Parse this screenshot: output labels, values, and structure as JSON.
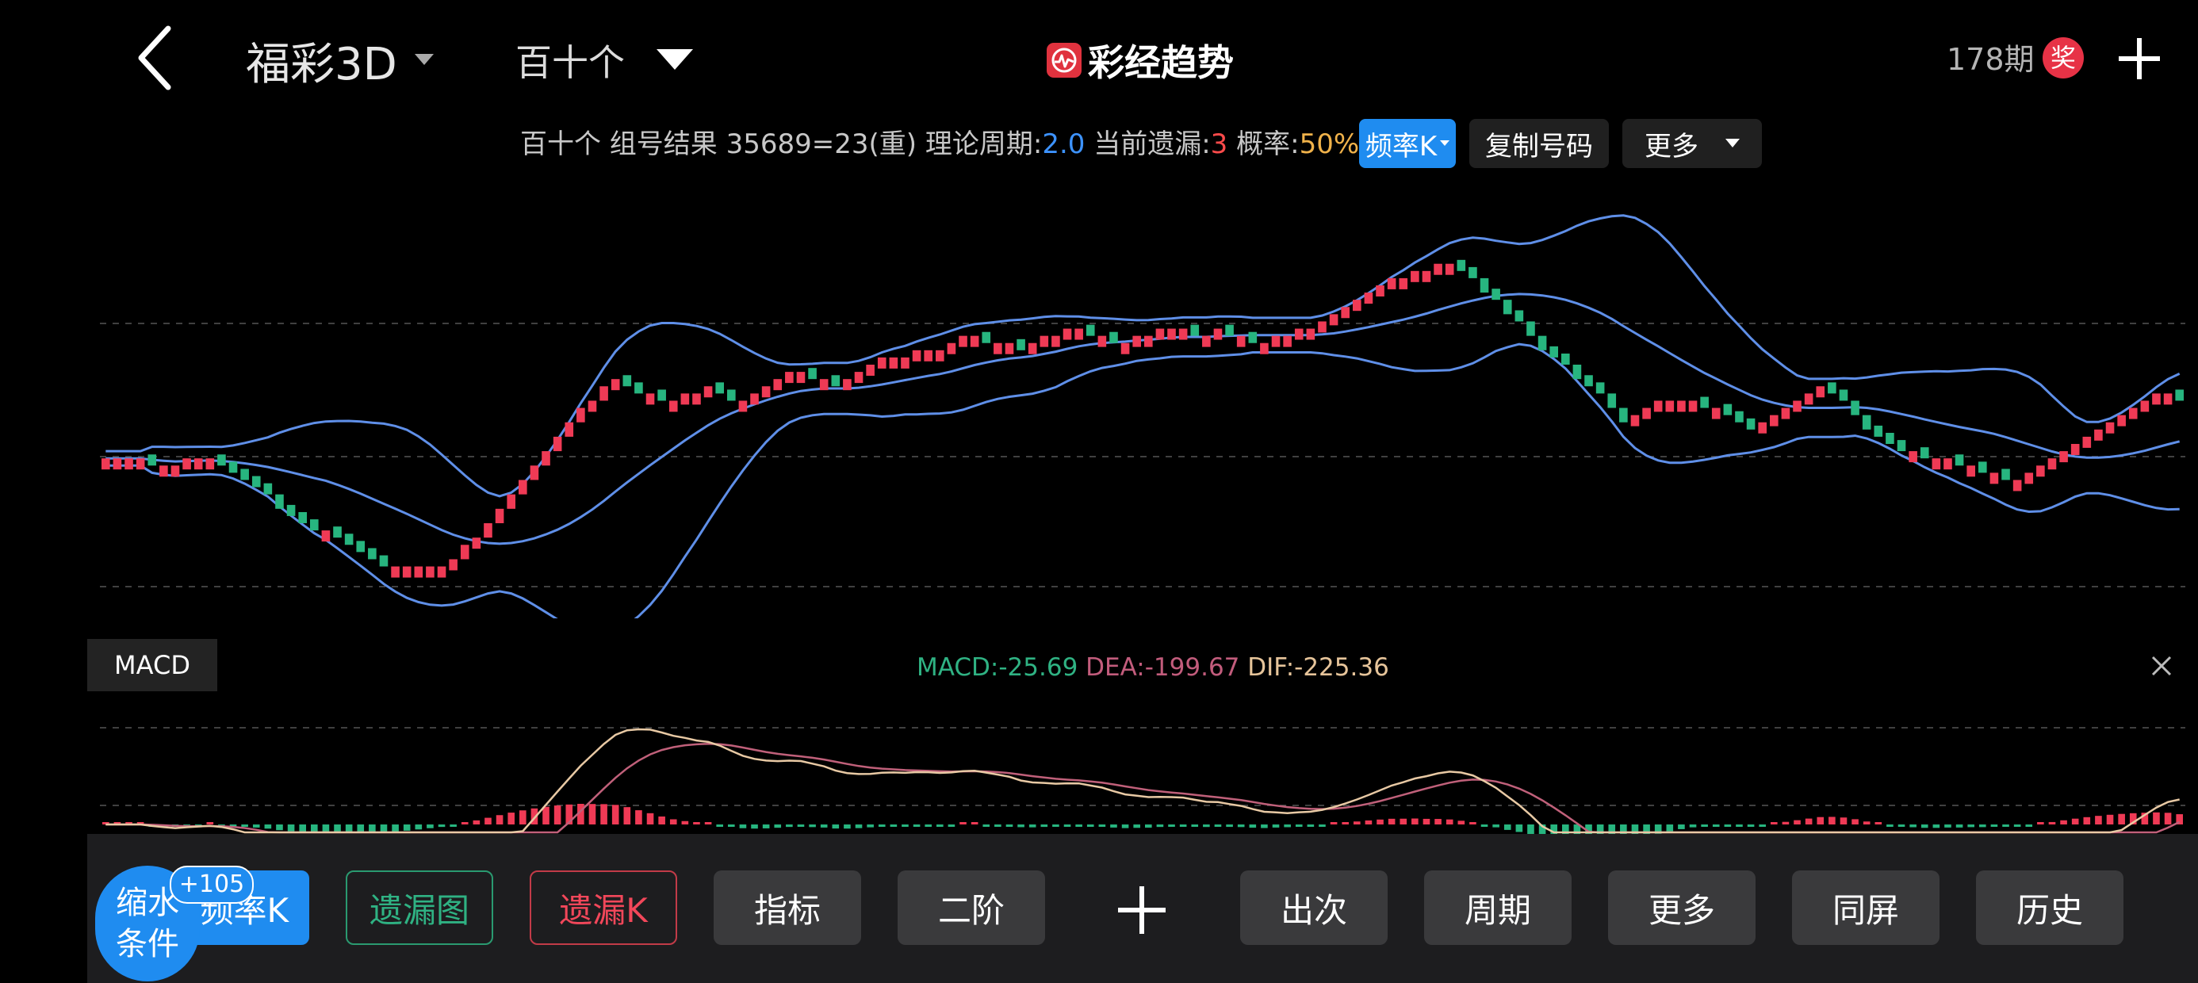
{
  "header": {
    "lottery_name": "福彩3D",
    "position_selector": "百十个",
    "app_title": "彩经趋势",
    "period_count": "178期",
    "prize_badge": "奖"
  },
  "info_bar": {
    "prefix": "百十个 组号结果 35689=23(重) 理论周期:",
    "theoretical_cycle": "2.0",
    "current_missing_label": " 当前遗漏:",
    "current_missing": "3",
    "probability_label": " 概率:",
    "probability": "50%",
    "freq_k_button": "频率K",
    "copy_button": "复制号码",
    "more_button": "更多"
  },
  "macd": {
    "label": "MACD",
    "macd_text": "MACD:-25.69",
    "dea_text": "DEA:-199.67",
    "dif_text": "DIF:-225.36"
  },
  "toolbar": {
    "shrink_line1": "缩水",
    "shrink_line2": "条件",
    "count_badge": "+105",
    "freq_k": "频率K",
    "missing_chart": "遗漏图",
    "missing_k": "遗漏K",
    "indicator": "指标",
    "second_order": "二阶",
    "occurrences": "出次",
    "period": "周期",
    "more": "更多",
    "split_screen": "同屏",
    "history": "历史"
  },
  "colors": {
    "background": "#000000",
    "up": "#ef3a55",
    "down": "#27b57f",
    "band": "#5f8fe8",
    "accent_blue": "#1f8cf0",
    "dif_line": "#e8c9a4",
    "dea_line": "#c0607a"
  },
  "chart_data": [
    {
      "type": "candlestick",
      "title": "",
      "candle_count": 180,
      "series": [
        {
          "values": [
            50,
            50,
            50,
            50,
            49,
            49,
            49,
            50,
            50,
            50,
            49,
            48,
            47,
            46,
            45,
            43,
            42,
            41,
            40,
            40,
            39,
            38,
            37,
            36,
            35,
            35,
            35,
            35,
            35,
            35,
            36,
            38,
            39,
            41,
            43,
            45,
            47,
            49,
            51,
            53,
            55,
            57,
            58,
            60,
            61,
            60,
            59,
            59,
            58,
            58,
            59,
            59,
            60,
            59,
            58,
            58,
            59,
            60,
            61,
            62,
            62,
            61,
            61,
            60,
            61,
            62,
            63,
            64,
            64,
            64,
            65,
            65,
            65,
            66,
            67,
            67,
            66,
            66,
            66,
            65,
            66,
            67,
            67,
            68,
            68,
            67,
            67,
            66,
            66,
            67,
            67,
            68,
            68,
            68,
            67,
            67,
            68,
            67,
            67,
            66,
            66,
            67,
            67,
            68,
            68,
            69,
            70,
            71,
            72,
            73,
            74,
            75,
            75,
            76,
            76,
            77,
            77,
            76,
            75,
            73,
            72,
            70,
            69,
            67,
            65,
            64,
            63,
            61,
            60,
            59,
            57,
            55,
            56,
            57,
            58,
            58,
            58,
            58,
            57,
            57,
            56,
            55,
            54,
            55,
            56,
            57,
            58,
            59,
            60,
            59,
            58,
            56,
            54,
            53,
            52,
            51,
            51,
            50,
            50,
            50,
            49,
            49,
            48,
            48,
            47,
            47,
            48,
            49,
            50,
            51,
            52,
            53,
            54,
            55,
            56,
            57,
            58,
            59,
            59,
            58
          ]
        }
      ],
      "ylim": [
        30,
        85
      ],
      "grid": true
    },
    {
      "type": "line",
      "title": "",
      "series": [
        {
          "name": "MACD",
          "values": [
            -25.69
          ]
        },
        {
          "name": "DEA",
          "values": [
            -199.67
          ]
        },
        {
          "name": "DIF",
          "values": [
            -225.36
          ]
        }
      ],
      "grid": true
    }
  ]
}
